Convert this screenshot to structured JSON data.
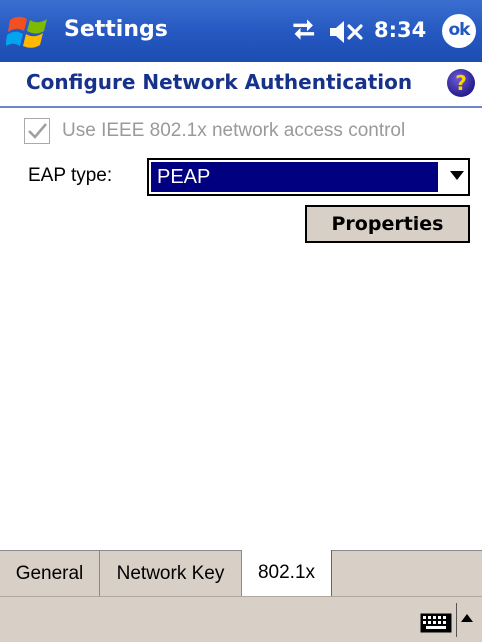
{
  "titlebar": {
    "title": "Settings",
    "time": "8:34",
    "ok_label": "ok",
    "icons": {
      "start": "windows-flag-icon",
      "connectivity": "connectivity-icon",
      "volume": "volume-muted-icon"
    }
  },
  "page": {
    "title": "Configure Network Authentication",
    "help_icon": "help-icon"
  },
  "form": {
    "ieee_checkbox": {
      "label": "Use IEEE 802.1x network access control",
      "checked": true,
      "disabled": true
    },
    "eap_type": {
      "label": "EAP type:",
      "value": "PEAP"
    },
    "properties_label": "Properties"
  },
  "tabs": [
    {
      "label": "General",
      "selected": false
    },
    {
      "label": "Network Key",
      "selected": false
    },
    {
      "label": "802.1x",
      "selected": true
    }
  ],
  "menubar": {
    "input_icon": "keyboard-icon",
    "sip_arrow": "up-arrow-icon"
  },
  "colors": {
    "titlebar": "#2457c0",
    "page_title": "#17328a",
    "selection": "#000080",
    "chrome": "#d8cfc6"
  }
}
